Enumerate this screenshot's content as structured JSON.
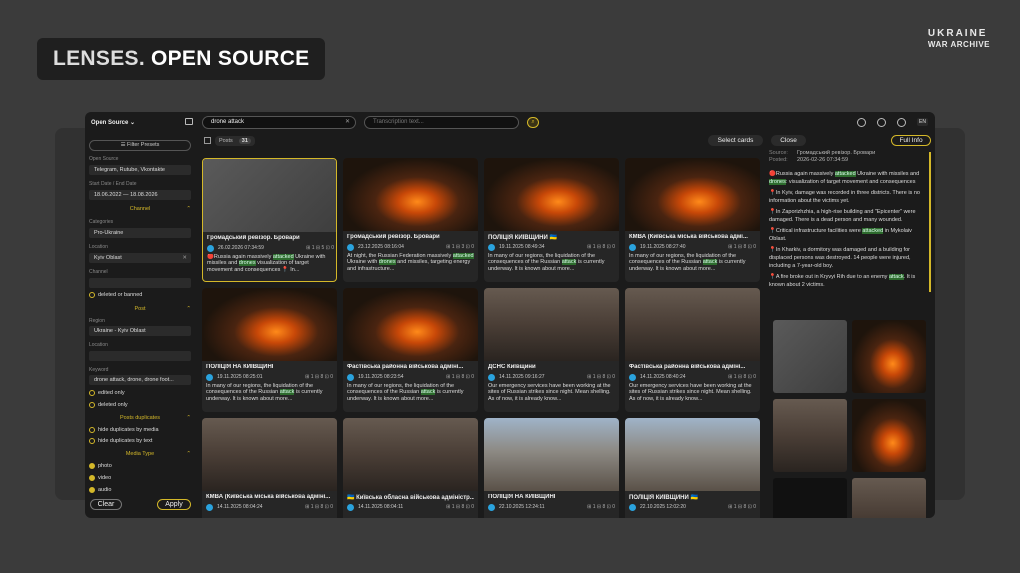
{
  "hero": {
    "lenses": "LENSES.",
    "title": "OPEN SOURCE"
  },
  "brand": {
    "line1": "UKRAINE",
    "line2": "WAR ARCHIVE"
  },
  "topbar": {
    "source_selector": "Open Source ⌄",
    "search_value": "drone attack",
    "transcription_placeholder": "Transcription text...",
    "language": "EN"
  },
  "sidebar": {
    "filter_presets": "☰ Filter Presets",
    "open_source_label": "Open Source",
    "open_source_value": "Telegram, Rutube, Vkontakte",
    "date_label": "Start Date / End Date",
    "date_value": "18.06.2022 — 18.08.2026",
    "channel_section": "Channel",
    "categories_label": "Categories",
    "categories_value": "Pro-Ukraine",
    "location_label": "Location",
    "location_value": "Kyiv Oblast",
    "channel_label": "Channel",
    "deleted_opt": "deleted or banned",
    "post_section": "Post",
    "region_label": "Region",
    "region_value": "Ukraine - Kyiv Oblast",
    "post_location_label": "Location",
    "keyword_label": "Keyword",
    "keyword_value": "drone attack, drone, drone foot...",
    "edited_opt": "edited only",
    "deleted_only_opt": "deleted only",
    "dup_section": "Posts duplicates",
    "dup_media": "hide duplicates by media",
    "dup_text": "hide duplicates by text",
    "media_section": "Media Type",
    "photo": "photo",
    "video": "video",
    "audio": "audio",
    "clear": "Clear",
    "apply": "Apply"
  },
  "subbar": {
    "posts_label": "Posts",
    "posts_count": "31",
    "select_cards": "Select cards",
    "close": "Close",
    "full_info": "Full Info"
  },
  "cards": [
    {
      "title": "Громадський ревізор. Бровари",
      "date": "26.02.2026 07:34:59",
      "stats": "⊞ 1  ⊟ 5  ⊡ 0",
      "pre": "🔴Russia again massively ",
      "hl": "attacked",
      "post": " Ukraine with missiles and ",
      "hl2": "drones",
      "post2": " visualization of target movement and consequences 📍 In...",
      "kind": "map"
    },
    {
      "title": "Громадський ревізор. Бровари",
      "date": "23.12.2025 08:16:04",
      "stats": "⊞ 1  ⊟ 3  ⊡ 0",
      "pre": "At night, the Russian Federation massively ",
      "hl": "attacked",
      "post": " Ukraine with ",
      "hl2": "drones",
      "post2": " and missiles, targeting energy and infrastructure...",
      "kind": "fire"
    },
    {
      "title": "ПОЛІЦІЯ КИЇВЩИНИ 🇺🇦",
      "date": "19.11.2025 08:49:34",
      "stats": "⊞ 1  ⊟ 8  ⊡ 0",
      "pre": "In many of our regions, the liquidation of the consequences of the Russian ",
      "hl": "attack",
      "post": " is currently underway. It is known about more...",
      "hl2": "",
      "post2": "",
      "kind": "fire"
    },
    {
      "title": "КМВА (Київська міська військова адмі...",
      "date": "19.11.2025 08:27:40",
      "stats": "⊞ 1  ⊟ 8  ⊡ 0",
      "pre": "In many of our regions, the liquidation of the consequences of the Russian ",
      "hl": "attack",
      "post": " is currently underway. It is known about more...",
      "hl2": "",
      "post2": "",
      "kind": "fire"
    },
    {
      "title": "ПОЛІЦІЯ НА КИЇВЩИНІ",
      "date": "19.11.2025 08:25:01",
      "stats": "⊞ 1  ⊟ 8  ⊡ 0",
      "pre": "In many of our regions, the liquidation of the consequences of the Russian ",
      "hl": "attack",
      "post": " is currently underway. It is known about more...",
      "hl2": "",
      "post2": "",
      "kind": "fire"
    },
    {
      "title": "Фастівська районна військова адміні...",
      "date": "19.11.2025 08:23:54",
      "stats": "⊞ 1  ⊟ 8  ⊡ 0",
      "pre": "In many of our regions, the liquidation of the consequences of the Russian ",
      "hl": "attack",
      "post": " is currently underway. It is known about more...",
      "hl2": "",
      "post2": "",
      "kind": "fire"
    },
    {
      "title": "ДСНС Київщини",
      "date": "14.11.2025 09:16:27",
      "stats": "⊞ 1  ⊟ 8  ⊡ 0",
      "pre": "Our emergency services have been working at the sites of Russian strikes since night. Mean shelling. As of now, it is already know...",
      "hl": "",
      "post": "",
      "hl2": "",
      "post2": "",
      "kind": "bldg"
    },
    {
      "title": "Фастівська районна військова адміні...",
      "date": "14.11.2025 08:40:24",
      "stats": "⊞ 1  ⊟ 8  ⊡ 0",
      "pre": "Our emergency services have been working at the sites of Russian strikes since night. Mean shelling. As of now, it is already know...",
      "hl": "",
      "post": "",
      "hl2": "",
      "post2": "",
      "kind": "bldg"
    },
    {
      "title": "КМВА (Київська міська військова адміні...",
      "date": "14.11.2025 08:04:24",
      "stats": "⊞ 1  ⊟ 8  ⊡ 0",
      "pre": "",
      "hl": "",
      "post": "",
      "hl2": "",
      "post2": "",
      "kind": "bldg"
    },
    {
      "title": "🇺🇦 Київська обласна військова адміністр...",
      "date": "14.11.2025 08:04:11",
      "stats": "⊞ 1  ⊟ 8  ⊡ 0",
      "pre": "",
      "hl": "",
      "post": "",
      "hl2": "",
      "post2": "",
      "kind": "bldg"
    },
    {
      "title": "ПОЛІЦІЯ НА КИЇВЩИНІ",
      "date": "22.10.2025 12:24:11",
      "stats": "⊞ 1  ⊟ 8  ⊡ 0",
      "pre": "",
      "hl": "",
      "post": "",
      "hl2": "",
      "post2": "",
      "kind": "ruin"
    },
    {
      "title": "ПОЛІЦІЯ КИЇВЩИНИ 🇺🇦",
      "date": "22.10.2025 12:02:20",
      "stats": "⊞ 1  ⊟ 8  ⊡ 0",
      "pre": "",
      "hl": "",
      "post": "",
      "hl2": "",
      "post2": "",
      "kind": "ruin"
    }
  ],
  "detail": {
    "source_label": "Source:",
    "source_value": "Громадський ревізор. Бровари",
    "posted_label": "Posted:",
    "posted_value": "2026-02-26 07:34:59",
    "p1_pre": "🔴Russia again massively ",
    "p1_hl": "attacked",
    "p1_mid": " Ukraine with missiles and ",
    "p1_hl2": "drones",
    "p1_post": ": visualization of target movement and consequences",
    "p2": "📍In Kyiv, damage was recorded in three districts. There is no information about the victims yet.",
    "p3": "📍In Zaporizhzhia, a high-rise building and \"Epicenter\" were damaged. There is a dead person and many wounded.",
    "p4_pre": "📍Critical infrastructure facilities were ",
    "p4_hl": "attacked",
    "p4_post": " in Mykolaiv Oblast.",
    "p5": "📍In Kharkiv, a dormitory was damaged and a building for displaced persons was destroyed. 14 people were injured, including a 7-year-old boy.",
    "p6_pre": "📍A fire broke out in Kryvyi Rih due to an enemy ",
    "p6_hl": "attack",
    "p6_post": ". It is known about 2 victims."
  }
}
